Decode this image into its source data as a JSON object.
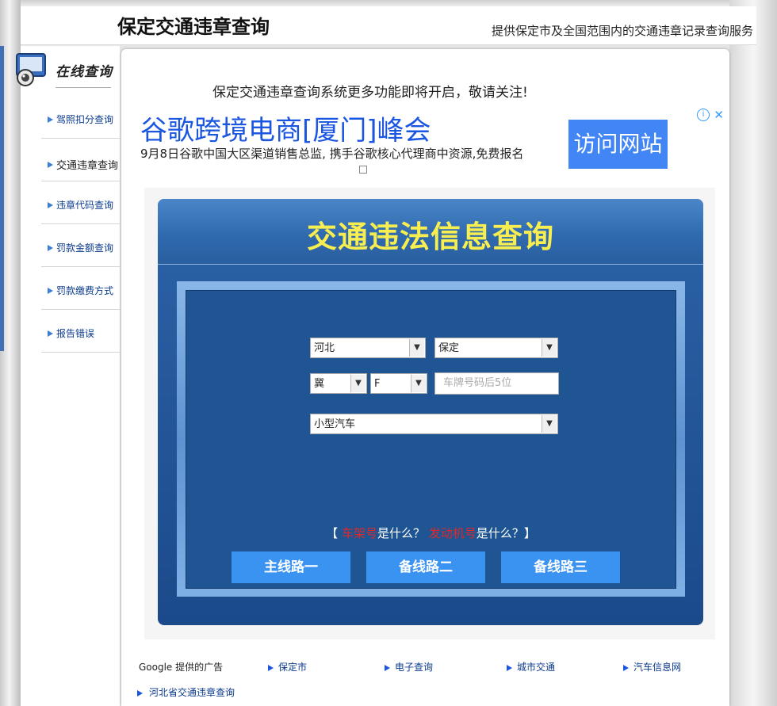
{
  "header": {
    "title": "保定交通违章查询",
    "tagline": "提供保定市及全国范围内的交通违章记录查询服务"
  },
  "sidebar": {
    "heading": "在线查询",
    "items": [
      {
        "label": "驾照扣分查询"
      },
      {
        "label": "交通违章查询"
      },
      {
        "label": "违章代码查询"
      },
      {
        "label": "罚款金额查询"
      },
      {
        "label": "罚款缴费方式"
      },
      {
        "label": "报告错误"
      }
    ]
  },
  "notice": "保定交通违章查询系统更多功能即将开启，敬请关注!",
  "ad": {
    "title": "谷歌跨境电商[厦门]峰会",
    "description": "9月8日谷歌中国大区渠道销售总监, 携手谷歌核心代理商中资源,免费报名",
    "button": "访问网站",
    "info_icon": "i",
    "close_icon": "✕"
  },
  "query": {
    "title": "交通违法信息查询",
    "province": "河北",
    "city": "保定",
    "plate_prefix": "冀",
    "plate_letter": "F",
    "plate_placeholder": "车牌号码后5位",
    "vehicle_type": "小型汽车",
    "help": {
      "open": "【",
      "frame_link": "车架号",
      "q1": "是什么？",
      "engine_link": "发动机号",
      "q2": "是什么？",
      "close": "】"
    },
    "routes": [
      "主线路一",
      "备线路二",
      "备线路三"
    ]
  },
  "links": {
    "google_label": "Google 提供的广告",
    "items": [
      "保定市",
      "电子查询",
      "城市交通",
      "汽车信息网"
    ]
  },
  "bottom_link": "河北省交通违章查询",
  "colors": {
    "accent_blue": "#1a56e0",
    "panel_blue": "#1e5592",
    "title_yellow": "#f8ee50",
    "button_blue": "#3a93f0",
    "help_red": "#e0282a"
  }
}
